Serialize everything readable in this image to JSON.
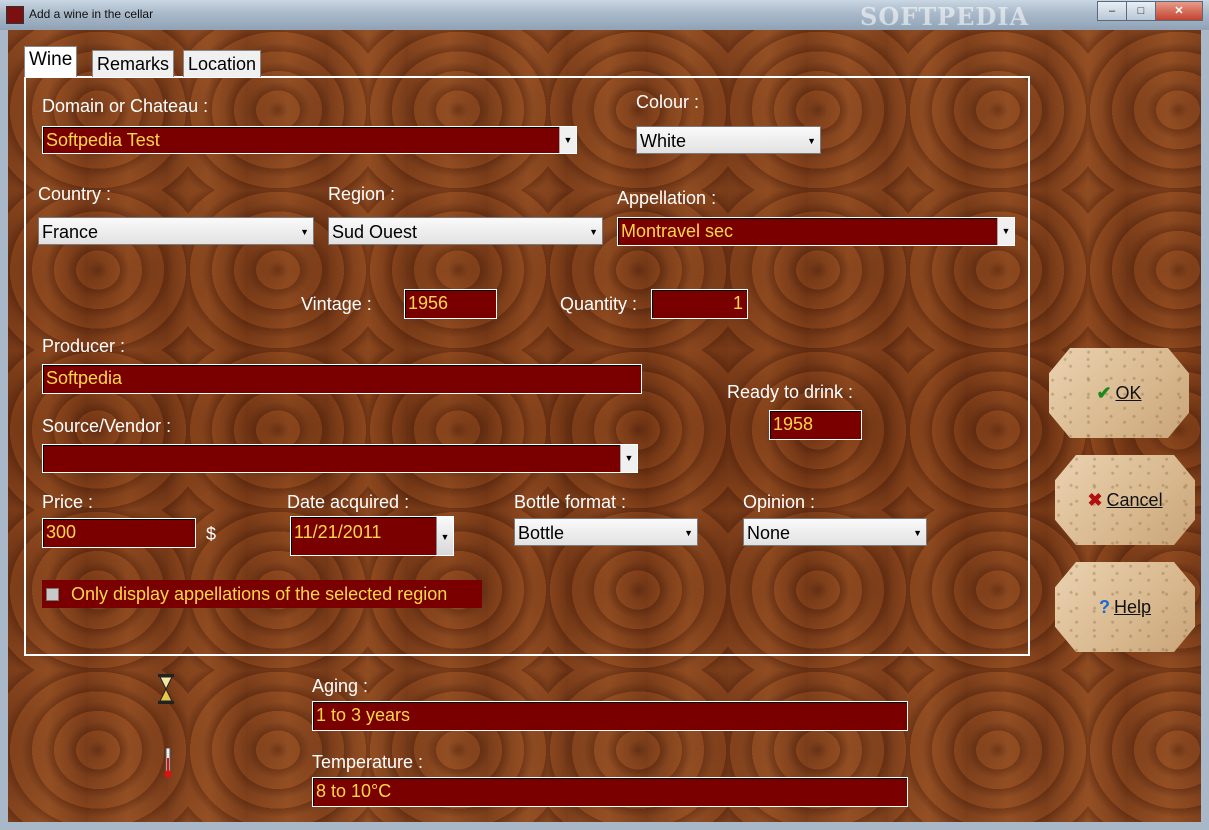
{
  "window": {
    "title": "Add a wine in the cellar",
    "watermark": "SOFTPEDIA",
    "minimize": "–",
    "maximize": "□",
    "close": "✕"
  },
  "tabs": [
    "Wine",
    "Remarks",
    "Location"
  ],
  "form": {
    "domain_label": "Domain or Chateau :",
    "domain_value": "Softpedia Test",
    "colour_label": "Colour :",
    "colour_value": "White",
    "country_label": "Country :",
    "country_value": "France",
    "region_label": "Region :",
    "region_value": "Sud Ouest",
    "appellation_label": "Appellation :",
    "appellation_value": "Montravel sec",
    "vintage_label": "Vintage :",
    "vintage_value": "1956",
    "quantity_label": "Quantity :",
    "quantity_value": "1",
    "producer_label": "Producer :",
    "producer_value": "Softpedia",
    "ready_label": "Ready to drink :",
    "ready_value": "1958",
    "vendor_label": "Source/Vendor :",
    "vendor_value": "",
    "price_label": "Price :",
    "price_value": "300",
    "currency": "$",
    "date_label": "Date acquired :",
    "date_value": "11/21/2011",
    "format_label": "Bottle format :",
    "format_value": "Bottle",
    "opinion_label": "Opinion :",
    "opinion_value": "None",
    "only_appellations_label": "Only display appellations of the selected region"
  },
  "bottom": {
    "aging_label": "Aging :",
    "aging_value": "1 to 3 years",
    "temperature_label": "Temperature :",
    "temperature_value": "8 to 10°C"
  },
  "buttons": {
    "ok": "OK",
    "cancel": "Cancel",
    "help": "Help"
  }
}
